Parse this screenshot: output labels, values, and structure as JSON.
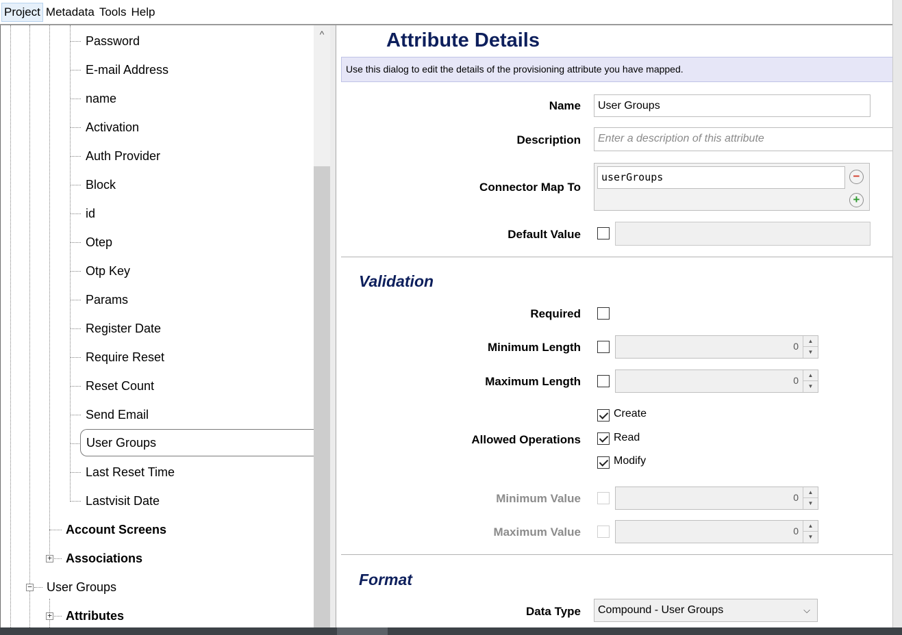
{
  "menu": [
    {
      "label": "Project",
      "active": true
    },
    {
      "label": "Metadata"
    },
    {
      "label": "Tools"
    },
    {
      "label": "Help"
    }
  ],
  "tree": {
    "items": [
      {
        "label": "Password",
        "bold": false,
        "selected": false
      },
      {
        "label": "E-mail Address",
        "bold": false,
        "selected": false
      },
      {
        "label": "name",
        "bold": false,
        "selected": false
      },
      {
        "label": "Activation",
        "bold": false,
        "selected": false
      },
      {
        "label": "Auth Provider",
        "bold": false,
        "selected": false
      },
      {
        "label": "Block",
        "bold": false,
        "selected": false
      },
      {
        "label": "id",
        "bold": false,
        "selected": false
      },
      {
        "label": "Otep",
        "bold": false,
        "selected": false
      },
      {
        "label": "Otp Key",
        "bold": false,
        "selected": false
      },
      {
        "label": "Params",
        "bold": false,
        "selected": false
      },
      {
        "label": "Register Date",
        "bold": false,
        "selected": false
      },
      {
        "label": "Require Reset",
        "bold": false,
        "selected": false
      },
      {
        "label": "Reset Count",
        "bold": false,
        "selected": false
      },
      {
        "label": "Send Email",
        "bold": false,
        "selected": false
      },
      {
        "label": "User Groups",
        "bold": false,
        "selected": true
      },
      {
        "label": "Last Reset Time",
        "bold": false,
        "selected": false
      },
      {
        "label": "Lastvisit Date",
        "bold": false,
        "selected": false
      },
      {
        "label": "Account Screens",
        "bold": true,
        "selected": false
      },
      {
        "label": "Associations",
        "bold": true,
        "selected": false
      },
      {
        "label": "User Groups",
        "bold": false,
        "selected": false
      },
      {
        "label": "Attributes",
        "bold": true,
        "selected": false
      }
    ],
    "expanders": {
      "associations": "+",
      "user_groups": "−",
      "attributes": "+"
    },
    "scroll_up_glyph": "^"
  },
  "detail": {
    "title": "Attribute Details",
    "info": "Use this dialog to edit the details of the provisioning attribute you have mapped.",
    "name_label": "Name",
    "name_value": "User Groups",
    "description_label": "Description",
    "description_placeholder": "Enter a description of this attribute",
    "connector_label": "Connector Map To",
    "connector_value": "userGroups",
    "remove_glyph": "−",
    "add_glyph": "+",
    "default_label": "Default Value",
    "default_checked": false,
    "default_value": ""
  },
  "validation": {
    "title": "Validation",
    "required_label": "Required",
    "required_checked": false,
    "min_length_label": "Minimum Length",
    "min_length_value": "0",
    "max_length_label": "Maximum Length",
    "max_length_value": "0",
    "allowed_ops_label": "Allowed Operations",
    "operations": [
      {
        "label": "Create",
        "checked": true
      },
      {
        "label": "Read",
        "checked": true
      },
      {
        "label": "Modify",
        "checked": true
      }
    ],
    "min_value_label": "Minimum Value",
    "min_value_value": "0",
    "max_value_label": "Maximum Value",
    "max_value_value": "0",
    "spin_up": "▲",
    "spin_down": "▼"
  },
  "format": {
    "title": "Format",
    "data_type_label": "Data Type",
    "data_type_value": "Compound - User Groups",
    "chevron": "⌵"
  }
}
